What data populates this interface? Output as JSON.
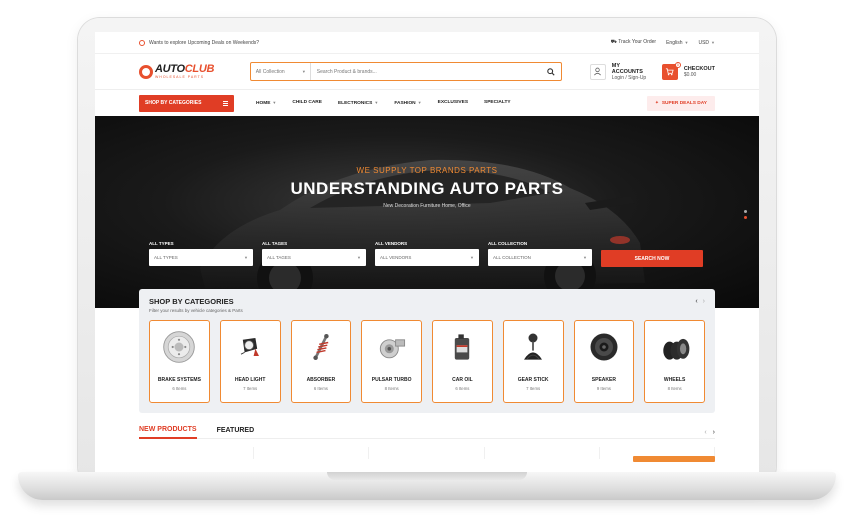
{
  "topbar": {
    "promo": "Wants to explore Upcoming Deals on Weekends?",
    "track_order": "Track Your Order",
    "language": "English",
    "currency": "USD"
  },
  "logo": {
    "brand_part1": "AUTO",
    "brand_part2": "CLUB",
    "tagline": "WHOLESALE PARTS"
  },
  "search": {
    "category": "All Collection",
    "placeholder": "Search Product & brands..."
  },
  "account": {
    "title": "MY ACCOUNTS",
    "subtitle": "Login / Sign-Up"
  },
  "cart": {
    "title": "CHECKOUT",
    "amount": "$0.00",
    "count": "0"
  },
  "nav": {
    "categories_button": "SHOP BY CATEGORIES",
    "items": [
      "HOME",
      "CHILD CARE",
      "ELECTRONICS",
      "FASHION",
      "EXCLUSIVES",
      "SPECIALTY"
    ],
    "deals": "SUPER DEALS DAY"
  },
  "hero": {
    "subtitle": "WE SUPPLY TOP BRANDS PARTS",
    "title": "UNDERSTANDING AUTO PARTS",
    "description": "New Decoration Furniture Home, Office"
  },
  "filters": [
    {
      "label": "ALL TYPES",
      "value": "ALL TYPES"
    },
    {
      "label": "ALL TAGES",
      "value": "ALL TAGES"
    },
    {
      "label": "ALL VENDORS",
      "value": "ALL VENDORS"
    },
    {
      "label": "ALL COLLECTION",
      "value": "ALL COLLECTION"
    }
  ],
  "filter_button": "SEARCH NOW",
  "categories": {
    "title": "SHOP BY CATEGORIES",
    "subtitle": "Filter your results by vehicle categories & Parts",
    "items": [
      {
        "name": "BRAKE SYSTEMS",
        "count": "6 Items",
        "icon": "brake-disc-icon"
      },
      {
        "name": "HEAD LIGHT",
        "count": "7 Items",
        "icon": "headlight-icon"
      },
      {
        "name": "ABSORBER",
        "count": "6 Items",
        "icon": "shock-absorber-icon"
      },
      {
        "name": "PULSAR TURBO",
        "count": "8 Items",
        "icon": "turbo-icon"
      },
      {
        "name": "CAR OIL",
        "count": "6 Items",
        "icon": "oil-can-icon"
      },
      {
        "name": "GEAR STICK",
        "count": "7 Items",
        "icon": "gear-stick-icon"
      },
      {
        "name": "SPEAKER",
        "count": "9 Items",
        "icon": "speaker-icon"
      },
      {
        "name": "WHEELS",
        "count": "8 Items",
        "icon": "wheels-icon"
      }
    ]
  },
  "products": {
    "tabs": [
      "NEW PRODUCTS",
      "FEATURED"
    ]
  },
  "colors": {
    "accent": "#e03d25",
    "orange": "#f08a33",
    "panel": "#eef0f3"
  }
}
